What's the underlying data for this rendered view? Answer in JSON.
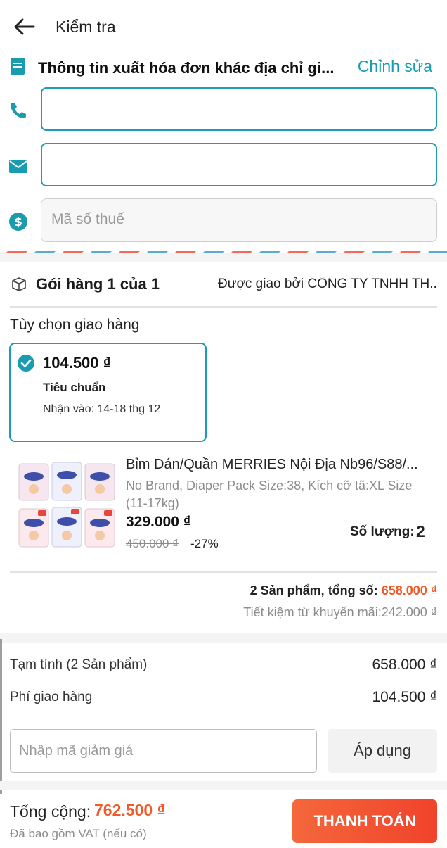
{
  "header": {
    "title": "Kiểm tra"
  },
  "invoice": {
    "title": "Thông tin xuất hóa đơn khác địa chỉ gi...",
    "edit_label": "Chỉnh sửa",
    "phone_value": "",
    "email_value": "",
    "tax_placeholder": "Mã số thuế"
  },
  "package": {
    "title": "Gói hàng 1 của 1",
    "seller": "Được giao bởi CÔNG TY TNHH TH..."
  },
  "shipping": {
    "section_label": "Tùy chọn giao hàng",
    "price": "104.500 ₫",
    "type": "Tiêu chuẩn",
    "eta": "Nhận vào: 14-18 thg 12"
  },
  "product": {
    "name": "Bỉm Dán/Quần MERRIES Nội Địa Nb96/S88/...",
    "variant": "No Brand, Diaper Pack Size:38, Kích cỡ tã:XL Size (11-17kg)",
    "price": "329.000 ₫",
    "original_price": "450.000 ₫",
    "discount": "-27%",
    "qty_label": "Số lượng:",
    "qty": "2",
    "image_icon": "diaper-pack-image"
  },
  "summary": {
    "items_label": "2 Sản phẩm, tổng số:",
    "items_total": "658.000 ₫",
    "savings": "Tiết kiệm từ khuyến mãi:242.000 ₫"
  },
  "costs": {
    "subtotal_label": "Tạm tính  (2 Sản phẩm)",
    "subtotal_value": "658.000 ₫",
    "shipping_label": "Phí giao hàng",
    "shipping_value": "104.500 ₫"
  },
  "coupon": {
    "placeholder": "Nhập mã giảm giá",
    "apply_label": "Áp dụng"
  },
  "footer": {
    "total_label": "Tổng cộng:",
    "total_value": "762.500 ₫",
    "vat_note": "Đã bao gồm VAT (nếu có)",
    "pay_label": "THANH TOÁN"
  },
  "colors": {
    "accent": "#1d9bb0",
    "orange": "#f05a28",
    "stripe_red": "#f26a5a",
    "stripe_blue": "#5aa9d6"
  }
}
